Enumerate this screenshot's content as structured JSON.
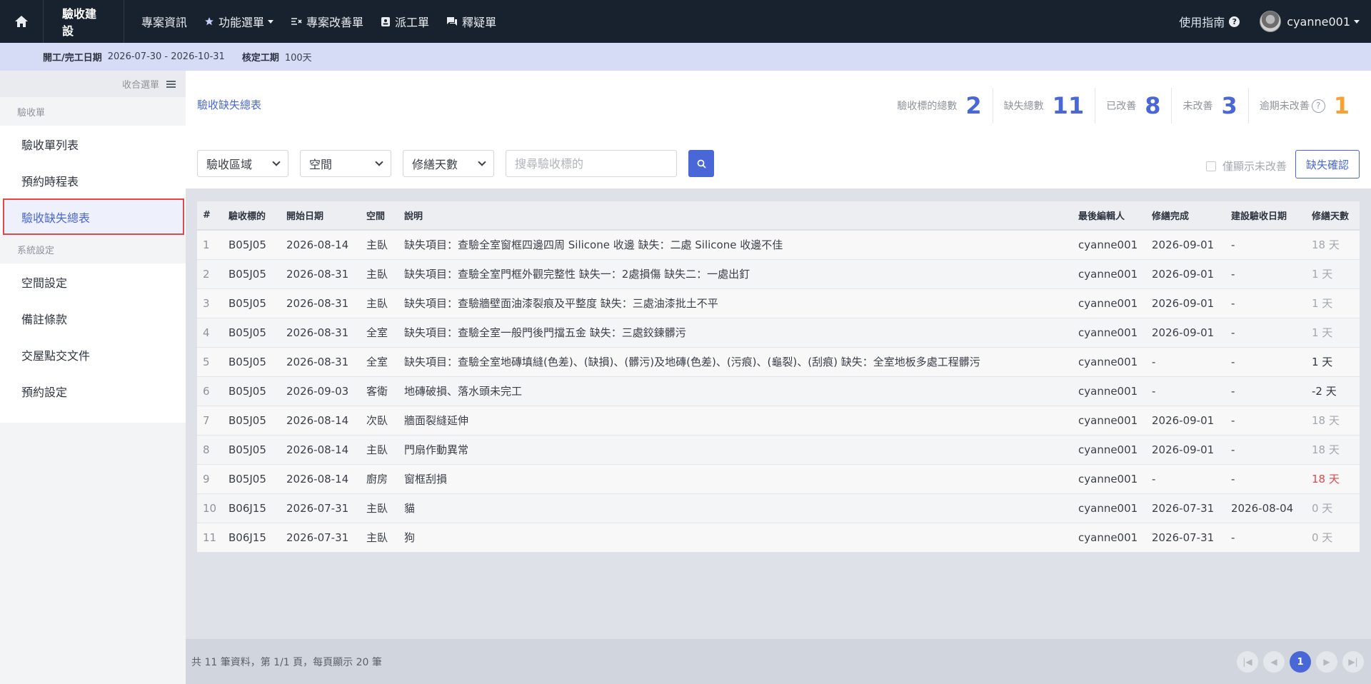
{
  "topbar": {
    "brand": "驗收建設",
    "nav": [
      {
        "label": "專案資訊",
        "icon": ""
      },
      {
        "label": "功能選單",
        "icon": "star-icon",
        "caret": true
      },
      {
        "label": "專案改善單",
        "icon": "improve-list-icon"
      },
      {
        "label": "派工單",
        "icon": "badge-icon"
      },
      {
        "label": "釋疑單",
        "icon": "chat-icon"
      }
    ],
    "guide": "使用指南",
    "username": "cyanne001"
  },
  "infobar": {
    "date_label": "開工/完工日期",
    "date_value": "2026-07-30 - 2026-10-31",
    "duration_label": "核定工期",
    "duration_value": "100天"
  },
  "sidebar": {
    "collapse_label": "收合選單",
    "section1": "驗收單",
    "section1_items": [
      "驗收單列表",
      "預約時程表",
      "驗收缺失總表"
    ],
    "section2": "系統設定",
    "section2_items": [
      "空間設定",
      "備註條款",
      "交屋點交文件",
      "預約設定"
    ]
  },
  "main": {
    "title": "驗收缺失總表",
    "stats": [
      {
        "label": "驗收標的總數",
        "value": "2",
        "color": "#4a67d8"
      },
      {
        "label": "缺失總數",
        "value": "11",
        "color": "#4a67d8"
      },
      {
        "label": "已改善",
        "value": "8",
        "color": "#4a67d8"
      },
      {
        "label": "未改善",
        "value": "3",
        "color": "#4a67d8"
      },
      {
        "label": "逾期未改善",
        "value": "1",
        "color": "#f5a233"
      }
    ],
    "filters": {
      "area": "驗收區域",
      "space": "空間",
      "repair_days": "修繕天數",
      "search_placeholder": "搜尋驗收標的",
      "only_unfixed": "僅顯示未改善",
      "confirm": "缺失確認"
    },
    "table": {
      "columns": [
        "#",
        "驗收標的",
        "開始日期",
        "空間",
        "說明",
        "最後編輯人",
        "修繕完成",
        "建設驗收日期",
        "修繕天數"
      ],
      "rows": [
        [
          "1",
          "B05J05",
          "2026-08-14",
          "主臥",
          "缺失項目：查驗全室窗框四邊四周 Silicone 收邊 缺失：二處 Silicone 收邊不佳",
          "cyanne001",
          "2026-09-01",
          "-",
          "18 天"
        ],
        [
          "2",
          "B05J05",
          "2026-08-31",
          "主臥",
          "缺失項目：查驗全室門框外觀完整性 缺失一：2處損傷 缺失二：一處出釘",
          "cyanne001",
          "2026-09-01",
          "-",
          "1 天"
        ],
        [
          "3",
          "B05J05",
          "2026-08-31",
          "主臥",
          "缺失項目：查驗牆壁面油漆裂痕及平整度 缺失：三處油漆批土不平",
          "cyanne001",
          "2026-09-01",
          "-",
          "1 天"
        ],
        [
          "4",
          "B05J05",
          "2026-08-31",
          "全室",
          "缺失項目：查驗全室一般門後門擋五金 缺失：三處鉸鍊髒污",
          "cyanne001",
          "2026-09-01",
          "-",
          "1 天"
        ],
        [
          "5",
          "B05J05",
          "2026-08-31",
          "全室",
          "缺失項目：查驗全室地磚填縫(色差)、(缺損)、(髒污)及地磚(色差)、(污痕)、(龜裂)、(刮痕) 缺失：全室地板多處工程髒污",
          "cyanne001",
          "-",
          "-",
          "1 天"
        ],
        [
          "6",
          "B05J05",
          "2026-09-03",
          "客衛",
          "地磚破損、落水頭未完工",
          "cyanne001",
          "-",
          "-",
          "-2 天"
        ],
        [
          "7",
          "B05J05",
          "2026-08-14",
          "次臥",
          "牆面裂縫延伸",
          "cyanne001",
          "2026-09-01",
          "-",
          "18 天"
        ],
        [
          "8",
          "B05J05",
          "2026-08-14",
          "主臥",
          "門扇作動異常",
          "cyanne001",
          "2026-09-01",
          "-",
          "18 天"
        ],
        [
          "9",
          "B05J05",
          "2026-08-14",
          "廚房",
          "窗框刮損",
          "cyanne001",
          "-",
          "-",
          "18 天"
        ],
        [
          "10",
          "B06J15",
          "2026-07-31",
          "主臥",
          "貓",
          "cyanne001",
          "2026-07-31",
          "2026-08-04",
          "0 天"
        ],
        [
          "11",
          "B06J15",
          "2026-07-31",
          "主臥",
          "狗",
          "cyanne001",
          "2026-07-31",
          "-",
          "0 天"
        ]
      ],
      "day_styles": [
        "muted",
        "muted",
        "muted",
        "muted",
        "dark",
        "dark",
        "muted",
        "muted",
        "red",
        "muted",
        "muted"
      ]
    },
    "footer": {
      "summary": "共 11 筆資料，第 1/1 頁，每頁顯示 20 筆",
      "current_page": "1"
    }
  }
}
